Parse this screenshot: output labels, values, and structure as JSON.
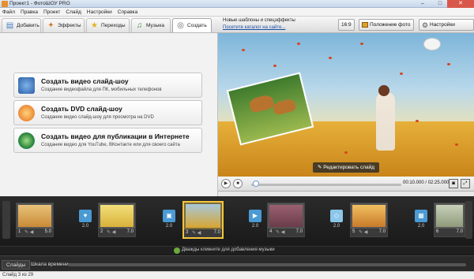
{
  "window": {
    "title": "Проект1 - ФотоШОУ PRO",
    "minimize": "–",
    "maximize": "□",
    "close": "✕"
  },
  "menu": [
    "Файл",
    "Правка",
    "Проект",
    "Слайд",
    "Настройки",
    "Справка"
  ],
  "tabs": [
    {
      "label": "Добавить",
      "icon": "folder-icon"
    },
    {
      "label": "Эффекты",
      "icon": "effects-icon"
    },
    {
      "label": "Переходы",
      "icon": "star-icon"
    },
    {
      "label": "Музыка",
      "icon": "music-icon"
    },
    {
      "label": "Создать",
      "icon": "disc-icon",
      "active": true
    }
  ],
  "create_options": [
    {
      "title": "Создать видео слайд-шоу",
      "subtitle": "Создание видеофайла для ПК, мобильных телефонов",
      "icon": "video-icon"
    },
    {
      "title": "Создать DVD слайд-шоу",
      "subtitle": "Создание видео слайд-шоу для просмотра на DVD",
      "icon": "dvd-icon"
    },
    {
      "title": "Создать видео для публикации в Интернете",
      "subtitle": "Создание видео для YouTube, ВКонтакте или для своего сайта",
      "icon": "globe-icon"
    }
  ],
  "toolbar": {
    "news_link": "Новые шаблоны и спецэффекты",
    "catalog_link": "Посетите каталог на сайте...",
    "aspect": "16:9",
    "photo_position": "Положение фото",
    "project_settings": "Настройки проекта"
  },
  "preview": {
    "edit_slide": "Редактировать слайд"
  },
  "player": {
    "time": "00:10.000 / 02:25.000",
    "progress": 0.07
  },
  "slides": [
    {
      "num": "1",
      "duration": "5.0",
      "color": "#c98a36"
    },
    {
      "num": "2",
      "duration": "7.0",
      "color": "#d8b13a"
    },
    {
      "num": "3",
      "duration": "7.0",
      "color": "#d7a532",
      "selected": true
    },
    {
      "num": "4",
      "duration": "7.0",
      "color": "#6b3c4a"
    },
    {
      "num": "5",
      "duration": "7.0",
      "color": "#c97a2a"
    },
    {
      "num": "6",
      "duration": "7.0",
      "color": "#8e9a7a"
    }
  ],
  "transitions": [
    {
      "duration": "2.0"
    },
    {
      "duration": "2.0"
    },
    {
      "duration": "2.0"
    },
    {
      "duration": "2.0"
    },
    {
      "duration": "2.0"
    }
  ],
  "music_hint": "Дважды кликните для добавления музыки",
  "bottom_tabs": [
    "Слайды",
    "Шкала времени"
  ],
  "status": "Слайд 3 из 29"
}
